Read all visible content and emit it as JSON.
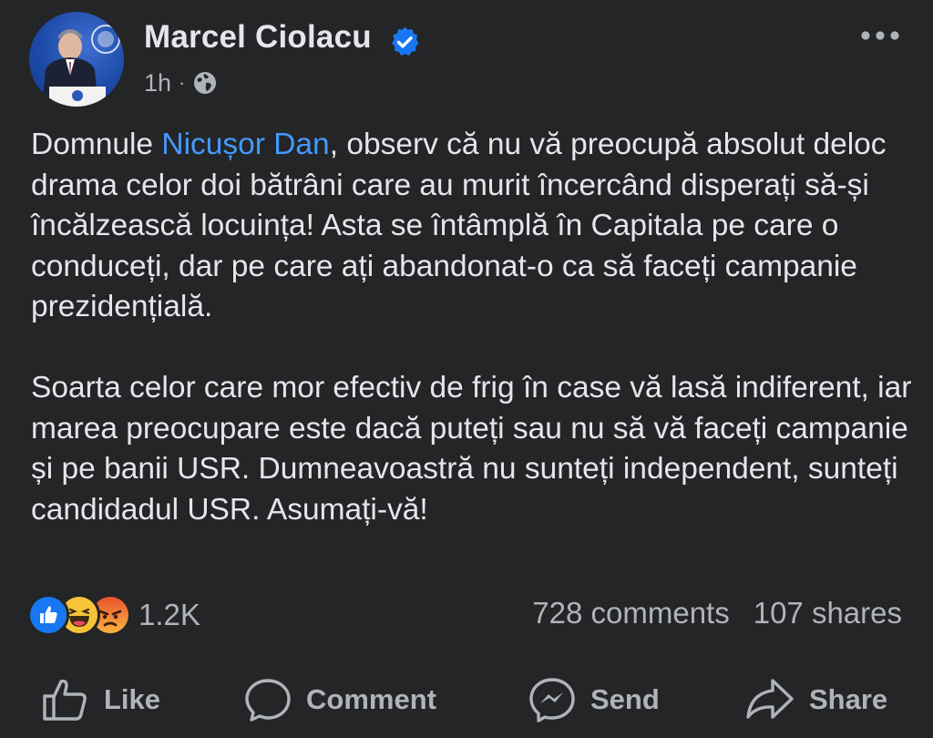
{
  "post": {
    "author": "Marcel Ciolacu",
    "verified": true,
    "timestamp": "1h",
    "separator": "·",
    "audience_icon": "globe-icon",
    "paragraphs": [
      {
        "before": "Domnule ",
        "mention": "Nicușor Dan",
        "after": ", observ că nu vă preocupă absolut deloc drama celor doi bătrâni care au murit încercând disperați să-și încălzească locuința! Asta se întâmplă în Capitala pe care o conduceți, dar pe care ați abandonat-o ca să faceți campanie prezidențială."
      },
      {
        "text": "Soarta celor care mor efectiv de frig în case vă lasă indiferent, iar marea preocupare este dacă puteți sau nu să vă faceți campanie și pe banii USR. Dumneavoastră nu sunteți independent, sunteți candidadul USR. Asumați-vă!"
      }
    ]
  },
  "engagement": {
    "reaction_icons": [
      "like-reaction-icon",
      "haha-reaction-icon",
      "angry-reaction-icon"
    ],
    "reaction_count": "1.2K",
    "comments": "728 comments",
    "shares": "107 shares"
  },
  "actions": {
    "like": "Like",
    "comment": "Comment",
    "send": "Send",
    "share": "Share"
  },
  "colors": {
    "background": "#242526",
    "text_primary": "#e4e6eb",
    "text_secondary": "#b0b3b8",
    "mention": "#4599ff",
    "verified": "#1877f2",
    "like_blue": "#1877f2",
    "angry_red": "#e9532f",
    "haha_yellow": "#f7c339"
  }
}
